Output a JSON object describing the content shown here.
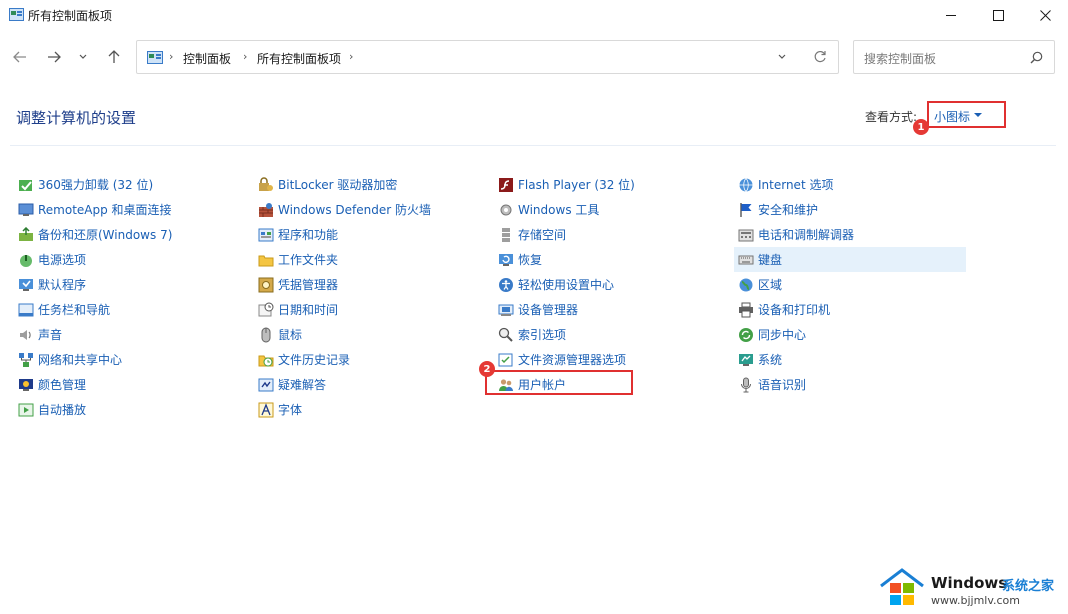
{
  "window": {
    "title": "所有控制面板项"
  },
  "address": {
    "crumbs": [
      "控制面板",
      "所有控制面板项"
    ],
    "search_placeholder": "搜索控制面板"
  },
  "header": {
    "page_title": "调整计算机的设置",
    "view_by_label": "查看方式:",
    "view_by_value": "小图标"
  },
  "annotations": {
    "badge1": "1",
    "badge2": "2",
    "highlight_color": "#e03030"
  },
  "columns": [
    [
      {
        "label": "360强力卸载 (32 位)",
        "icon": "uninstaller-icon"
      },
      {
        "label": "RemoteApp 和桌面连接",
        "icon": "remote-desktop-icon"
      },
      {
        "label": "备份和还原(Windows 7)",
        "icon": "backup-icon"
      },
      {
        "label": "电源选项",
        "icon": "power-icon"
      },
      {
        "label": "默认程序",
        "icon": "default-programs-icon"
      },
      {
        "label": "任务栏和导航",
        "icon": "taskbar-icon"
      },
      {
        "label": "声音",
        "icon": "sound-icon"
      },
      {
        "label": "网络和共享中心",
        "icon": "network-icon"
      },
      {
        "label": "颜色管理",
        "icon": "color-management-icon"
      },
      {
        "label": "自动播放",
        "icon": "autoplay-icon"
      }
    ],
    [
      {
        "label": "BitLocker 驱动器加密",
        "icon": "bitlocker-icon"
      },
      {
        "label": "Windows Defender 防火墙",
        "icon": "firewall-icon"
      },
      {
        "label": "程序和功能",
        "icon": "programs-icon"
      },
      {
        "label": "工作文件夹",
        "icon": "work-folders-icon"
      },
      {
        "label": "凭据管理器",
        "icon": "credential-icon"
      },
      {
        "label": "日期和时间",
        "icon": "datetime-icon"
      },
      {
        "label": "鼠标",
        "icon": "mouse-icon"
      },
      {
        "label": "文件历史记录",
        "icon": "file-history-icon"
      },
      {
        "label": "疑难解答",
        "icon": "troubleshoot-icon"
      },
      {
        "label": "字体",
        "icon": "fonts-icon"
      }
    ],
    [
      {
        "label": "Flash Player (32 位)",
        "icon": "flash-icon"
      },
      {
        "label": "Windows 工具",
        "icon": "windows-tools-icon"
      },
      {
        "label": "存储空间",
        "icon": "storage-icon"
      },
      {
        "label": "恢复",
        "icon": "recovery-icon"
      },
      {
        "label": "轻松使用设置中心",
        "icon": "ease-of-access-icon"
      },
      {
        "label": "设备管理器",
        "icon": "device-manager-icon"
      },
      {
        "label": "索引选项",
        "icon": "indexing-icon"
      },
      {
        "label": "文件资源管理器选项",
        "icon": "explorer-options-icon"
      },
      {
        "label": "用户帐户",
        "icon": "user-accounts-icon"
      }
    ],
    [
      {
        "label": "Internet 选项",
        "icon": "internet-icon"
      },
      {
        "label": "安全和维护",
        "icon": "security-flag-icon"
      },
      {
        "label": "电话和调制解调器",
        "icon": "phone-modem-icon"
      },
      {
        "label": "键盘",
        "icon": "keyboard-icon"
      },
      {
        "label": "区域",
        "icon": "region-icon"
      },
      {
        "label": "设备和打印机",
        "icon": "printer-icon"
      },
      {
        "label": "同步中心",
        "icon": "sync-icon"
      },
      {
        "label": "系统",
        "icon": "system-icon"
      },
      {
        "label": "语音识别",
        "icon": "microphone-icon"
      }
    ]
  ],
  "watermark": {
    "brand": "Windows",
    "brand_suffix": "系统之家",
    "url": "www.bjjmlv.com"
  }
}
